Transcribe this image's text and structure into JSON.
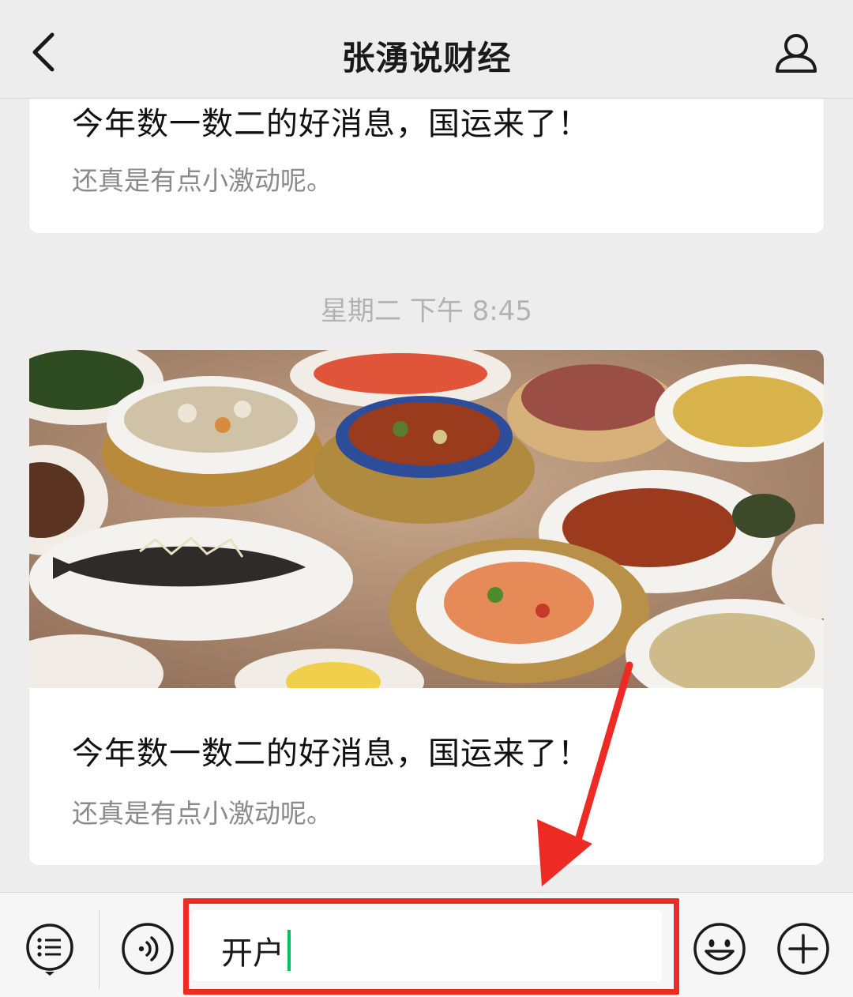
{
  "header": {
    "title": "张湧说财经",
    "back_icon": "chevron-left-icon",
    "profile_icon": "person-icon"
  },
  "messages": [
    {
      "title": "今年数一数二的好消息，国运来了！",
      "subtitle": "还真是有点小激动呢。"
    },
    {
      "timestamp": "星期二 下午 8:45",
      "cover_image": "banquet-dishes-photo",
      "title": "今年数一数二的好消息，国运来了！",
      "subtitle": "还真是有点小激动呢。"
    }
  ],
  "input_bar": {
    "menu_icon": "menu-list-icon",
    "voice_icon": "voice-icon",
    "input_value": "开户",
    "emoji_icon": "smiley-icon",
    "plus_icon": "plus-icon"
  },
  "annotation": {
    "color": "#ee2a24",
    "target": "message-input"
  },
  "colors": {
    "background": "#ededed",
    "caret": "#07c160",
    "annotation": "#ee2a24"
  }
}
